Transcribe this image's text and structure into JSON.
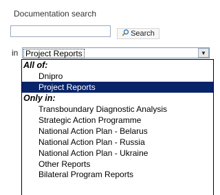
{
  "panel": {
    "title": "Documentation search"
  },
  "search": {
    "value": "",
    "button_label": "Search",
    "button_icon": "search-icon"
  },
  "filter": {
    "in_label": "in",
    "selected": "Project Reports",
    "groups": [
      {
        "label": "All of:",
        "options": [
          {
            "label": "Dnipro",
            "selected": false
          },
          {
            "label": "Project Reports",
            "selected": true
          }
        ]
      },
      {
        "label": "Only in:",
        "options": [
          {
            "label": "Transboundary Diagnostic Analysis",
            "selected": false
          },
          {
            "label": "Strategic Action Programme",
            "selected": false
          },
          {
            "label": "National Action Plan - Belarus",
            "selected": false
          },
          {
            "label": "National Action Plan - Russia",
            "selected": false
          },
          {
            "label": "National Action Plan - Ukraine",
            "selected": false
          },
          {
            "label": "Other Reports",
            "selected": false
          },
          {
            "label": "Bilateral Program Reports",
            "selected": false
          }
        ]
      }
    ]
  }
}
